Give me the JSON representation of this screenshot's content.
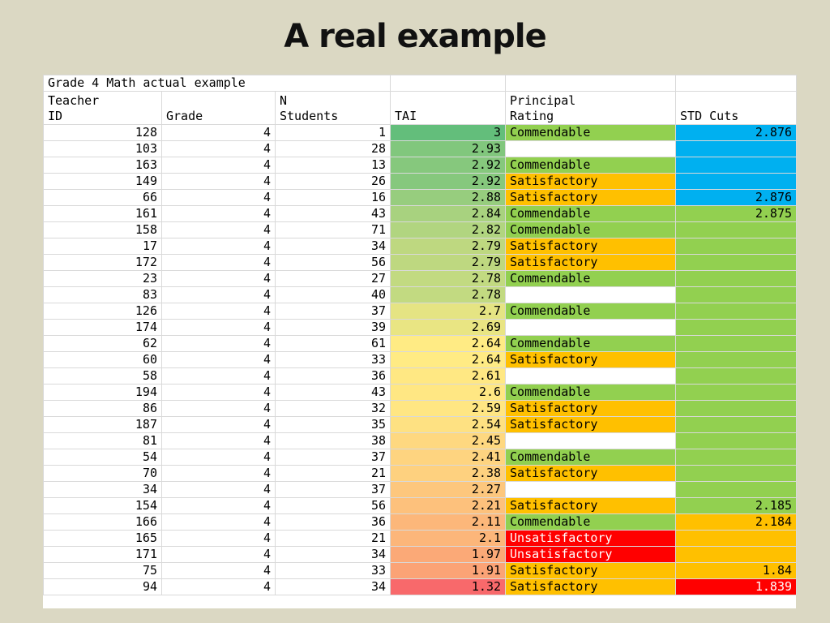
{
  "slide": {
    "title": "A real example"
  },
  "sheet": {
    "caption": "Grade 4 Math actual example",
    "headers": {
      "teacher_id_1": "Teacher",
      "teacher_id_2": "ID",
      "grade": "Grade",
      "n_students_1": "N",
      "n_students_2": "Students",
      "tai": "TAI",
      "rating_1": "Principal",
      "rating_2": "Rating",
      "std_cuts": "STD Cuts"
    },
    "colors": {
      "commendable": "#92d050",
      "satisfactory": "#ffc000",
      "unsatisfactory": "#ff0000",
      "std_blue": "#00b0f0",
      "std_green": "#92d050",
      "std_orange": "#ffc000",
      "std_red": "#ff0000",
      "tai_top": "#63be7b",
      "tai_mid": "#ffeb84",
      "tai_bottom": "#f8696b"
    },
    "rows": [
      {
        "id": "128",
        "grade": "4",
        "n": "1",
        "tai": "3",
        "rating": "Commendable",
        "cut": "2.876"
      },
      {
        "id": "103",
        "grade": "4",
        "n": "28",
        "tai": "2.93",
        "rating": "",
        "cut": ""
      },
      {
        "id": "163",
        "grade": "4",
        "n": "13",
        "tai": "2.92",
        "rating": "Commendable",
        "cut": ""
      },
      {
        "id": "149",
        "grade": "4",
        "n": "26",
        "tai": "2.92",
        "rating": "Satisfactory",
        "cut": ""
      },
      {
        "id": "66",
        "grade": "4",
        "n": "16",
        "tai": "2.88",
        "rating": "Satisfactory",
        "cut": "2.876"
      },
      {
        "id": "161",
        "grade": "4",
        "n": "43",
        "tai": "2.84",
        "rating": "Commendable",
        "cut": "2.875"
      },
      {
        "id": "158",
        "grade": "4",
        "n": "71",
        "tai": "2.82",
        "rating": "Commendable",
        "cut": ""
      },
      {
        "id": "17",
        "grade": "4",
        "n": "34",
        "tai": "2.79",
        "rating": "Satisfactory",
        "cut": ""
      },
      {
        "id": "172",
        "grade": "4",
        "n": "56",
        "tai": "2.79",
        "rating": "Satisfactory",
        "cut": ""
      },
      {
        "id": "23",
        "grade": "4",
        "n": "27",
        "tai": "2.78",
        "rating": "Commendable",
        "cut": ""
      },
      {
        "id": "83",
        "grade": "4",
        "n": "40",
        "tai": "2.78",
        "rating": "",
        "cut": ""
      },
      {
        "id": "126",
        "grade": "4",
        "n": "37",
        "tai": "2.7",
        "rating": "Commendable",
        "cut": ""
      },
      {
        "id": "174",
        "grade": "4",
        "n": "39",
        "tai": "2.69",
        "rating": "",
        "cut": ""
      },
      {
        "id": "62",
        "grade": "4",
        "n": "61",
        "tai": "2.64",
        "rating": "Commendable",
        "cut": ""
      },
      {
        "id": "60",
        "grade": "4",
        "n": "33",
        "tai": "2.64",
        "rating": "Satisfactory",
        "cut": ""
      },
      {
        "id": "58",
        "grade": "4",
        "n": "36",
        "tai": "2.61",
        "rating": "",
        "cut": ""
      },
      {
        "id": "194",
        "grade": "4",
        "n": "43",
        "tai": "2.6",
        "rating": "Commendable",
        "cut": ""
      },
      {
        "id": "86",
        "grade": "4",
        "n": "32",
        "tai": "2.59",
        "rating": "Satisfactory",
        "cut": ""
      },
      {
        "id": "187",
        "grade": "4",
        "n": "35",
        "tai": "2.54",
        "rating": "Satisfactory",
        "cut": ""
      },
      {
        "id": "81",
        "grade": "4",
        "n": "38",
        "tai": "2.45",
        "rating": "",
        "cut": ""
      },
      {
        "id": "54",
        "grade": "4",
        "n": "37",
        "tai": "2.41",
        "rating": "Commendable",
        "cut": ""
      },
      {
        "id": "70",
        "grade": "4",
        "n": "21",
        "tai": "2.38",
        "rating": "Satisfactory",
        "cut": ""
      },
      {
        "id": "34",
        "grade": "4",
        "n": "37",
        "tai": "2.27",
        "rating": "",
        "cut": ""
      },
      {
        "id": "154",
        "grade": "4",
        "n": "56",
        "tai": "2.21",
        "rating": "Satisfactory",
        "cut": "2.185"
      },
      {
        "id": "166",
        "grade": "4",
        "n": "36",
        "tai": "2.11",
        "rating": "Commendable",
        "cut": "2.184"
      },
      {
        "id": "165",
        "grade": "4",
        "n": "21",
        "tai": "2.1",
        "rating": "Unsatisfactory",
        "cut": ""
      },
      {
        "id": "171",
        "grade": "4",
        "n": "34",
        "tai": "1.97",
        "rating": "Unsatisfactory",
        "cut": ""
      },
      {
        "id": "75",
        "grade": "4",
        "n": "33",
        "tai": "1.91",
        "rating": "Satisfactory",
        "cut": "1.84"
      },
      {
        "id": "94",
        "grade": "4",
        "n": "34",
        "tai": "1.32",
        "rating": "Satisfactory",
        "cut": "1.839"
      }
    ],
    "std_cut_band_colors": [
      "std_blue",
      "std_blue",
      "std_blue",
      "std_blue",
      "std_blue",
      "std_green",
      "std_green",
      "std_green",
      "std_green",
      "std_green",
      "std_green",
      "std_green",
      "std_green",
      "std_green",
      "std_green",
      "std_green",
      "std_green",
      "std_green",
      "std_green",
      "std_green",
      "std_green",
      "std_green",
      "std_green",
      "std_green",
      "std_orange",
      "std_orange",
      "std_orange",
      "std_orange",
      "std_red"
    ]
  }
}
